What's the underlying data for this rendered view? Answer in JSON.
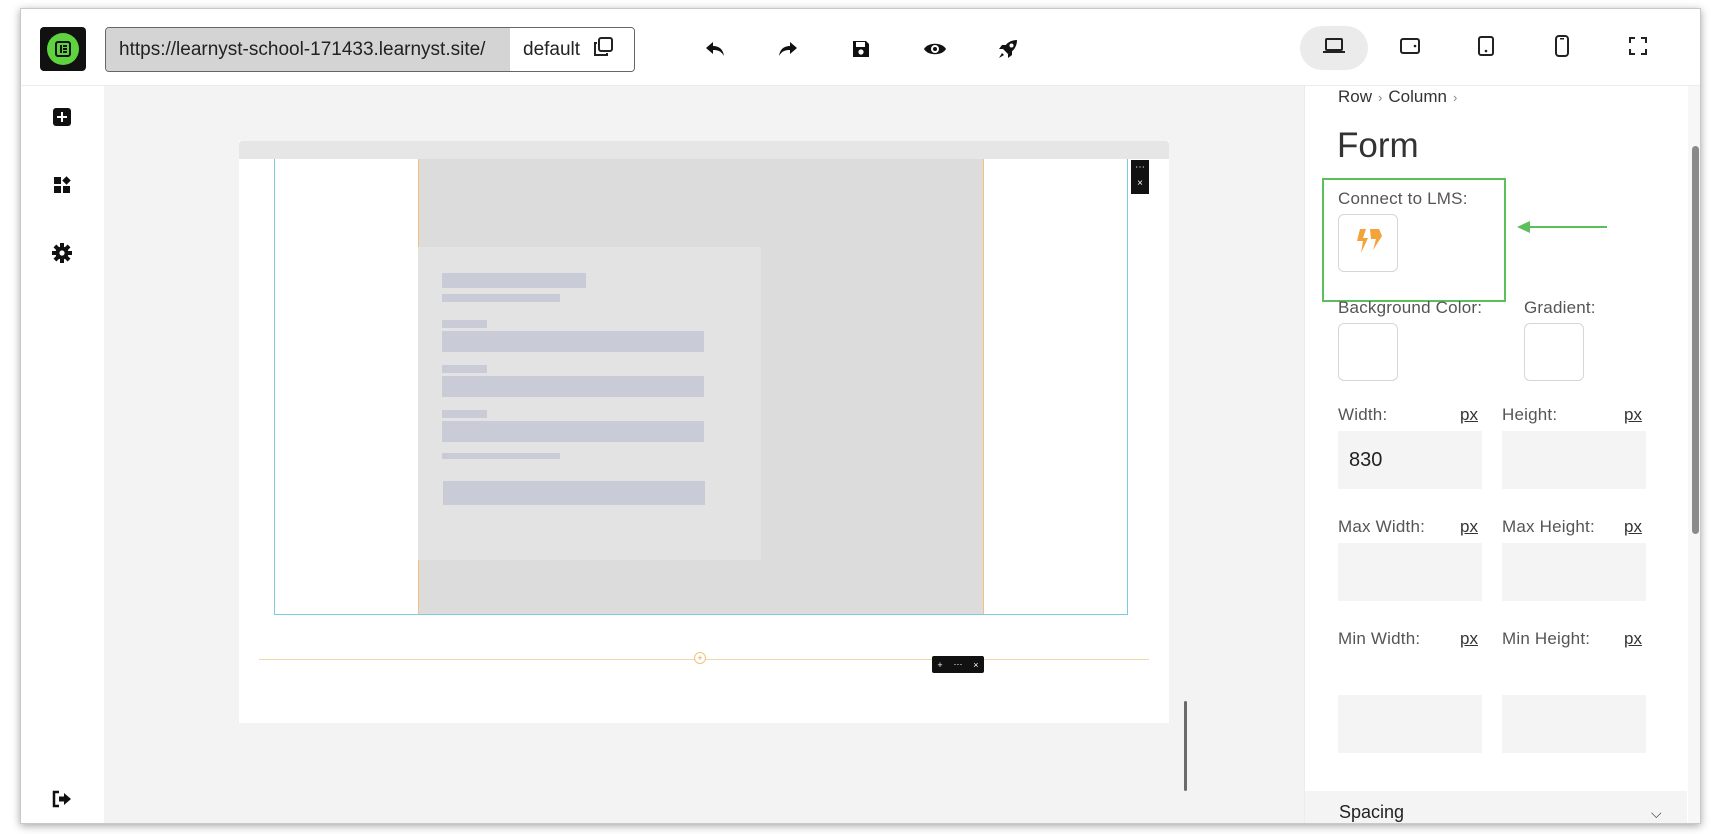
{
  "topbar": {
    "url": "https://learnyst-school-171433.learnyst.site/",
    "template": "default",
    "icons": [
      "undo-icon",
      "redo-icon",
      "save-icon",
      "preview-icon",
      "publish-icon"
    ],
    "devices": [
      "desktop-icon",
      "tablet-landscape-icon",
      "tablet-portrait-icon",
      "mobile-icon",
      "fullscreen-icon"
    ]
  },
  "sidebar": {
    "icons": [
      "add-element-icon",
      "widgets-icon",
      "settings-icon",
      "exit-icon"
    ]
  },
  "panel": {
    "breadcrumb": [
      "Row",
      "Column"
    ],
    "title": "Form",
    "connect_label": "Connect to LMS:",
    "background_label": "Background Color:",
    "gradient_label": "Gradient:",
    "width_label": "Width:",
    "width_unit": "px",
    "width_value": "830",
    "height_label": "Height:",
    "height_unit": "px",
    "height_value": "",
    "max_width_label": "Max Width:",
    "max_width_unit": "px",
    "max_height_label": "Max Height:",
    "max_height_unit": "px",
    "min_width_label": "Min Width:",
    "min_width_unit": "px",
    "min_height_label": "Min Height:",
    "min_height_unit": "px",
    "spacing_label": "Spacing"
  },
  "colors": {
    "accent_green": "#5cbf5c",
    "logo_green": "#5ed33f",
    "lms_icon_orange": "#f2a33a",
    "selection_blue": "#7ccbe0"
  }
}
